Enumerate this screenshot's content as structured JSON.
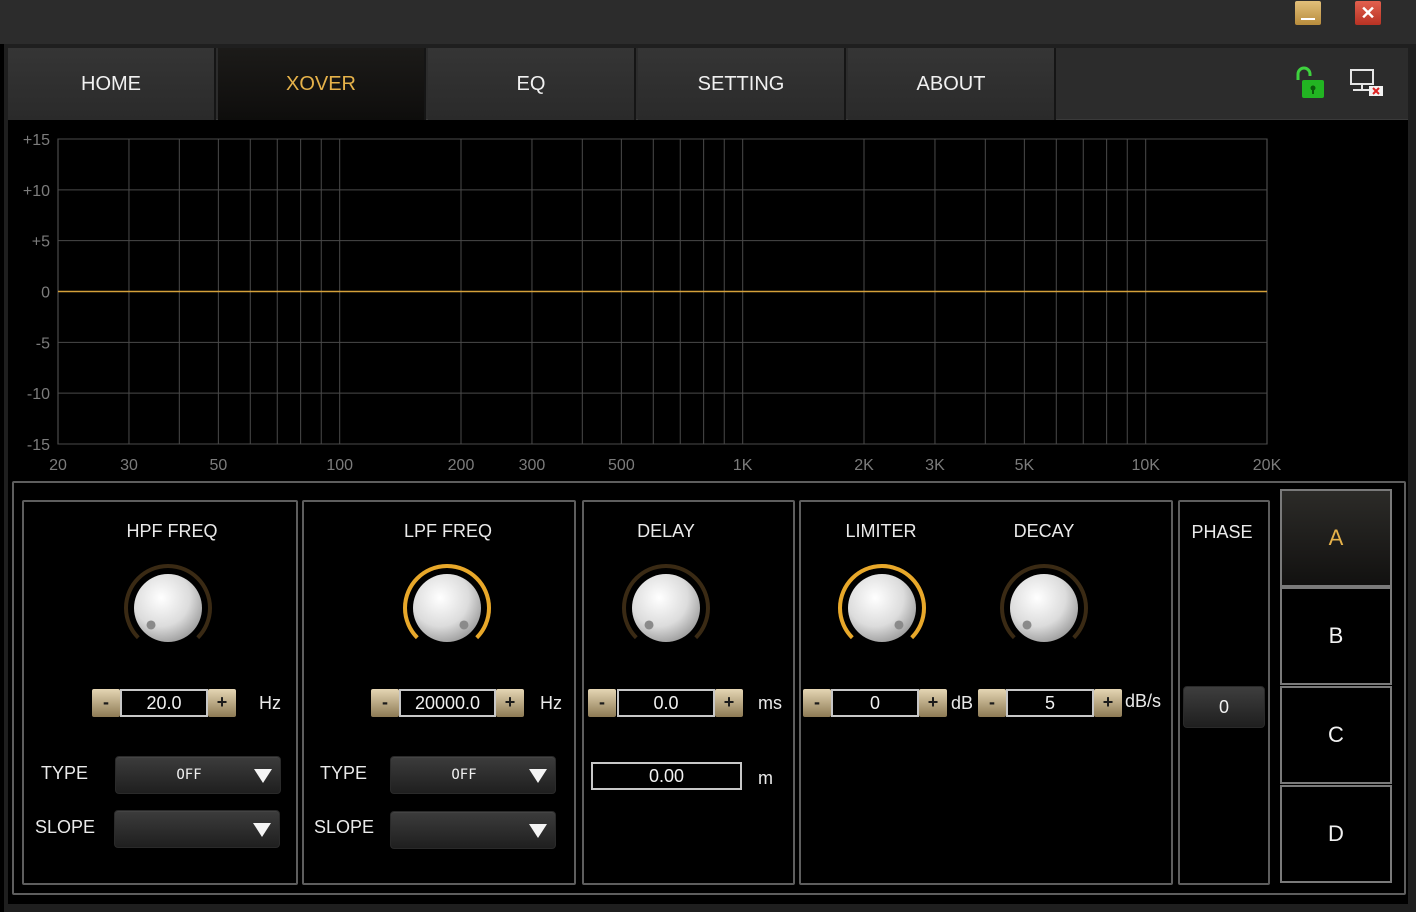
{
  "nav": {
    "tabs": [
      {
        "label": "HOME"
      },
      {
        "label": "XOVER",
        "active": true
      },
      {
        "label": "EQ"
      },
      {
        "label": "SETTING"
      },
      {
        "label": "ABOUT"
      }
    ],
    "icons": [
      "lock-open-icon",
      "network-disconnected-icon"
    ]
  },
  "graph": {
    "y_ticks": [
      "+15",
      "+10",
      "+5",
      "0",
      "-5",
      "-10",
      "-15"
    ],
    "x_ticks": [
      "20",
      "30",
      "50",
      "100",
      "200",
      "300",
      "500",
      "1K",
      "2K",
      "3K",
      "5K",
      "10K",
      "20K"
    ],
    "response_db": 0,
    "curve_color": "#d4a03a"
  },
  "hpf": {
    "title": "HPF FREQ",
    "value": "20.0",
    "unit": "Hz",
    "type_label": "TYPE",
    "type_value": "OFF",
    "slope_label": "SLOPE",
    "slope_value": "",
    "knob_level": 0.0
  },
  "lpf": {
    "title": "LPF FREQ",
    "value": "20000.0",
    "unit": "Hz",
    "type_label": "TYPE",
    "type_value": "OFF",
    "slope_label": "SLOPE",
    "slope_value": "",
    "knob_level": 1.0
  },
  "delay": {
    "title": "DELAY",
    "value": "0.0",
    "unit": "ms",
    "distance": "0.00",
    "distance_unit": "m",
    "knob_level": 0.0
  },
  "limiter": {
    "title": "LIMITER",
    "value": "0",
    "unit": "dB",
    "knob_level": 1.0
  },
  "decay": {
    "title": "DECAY",
    "value": "5",
    "unit": "dB/s",
    "knob_level": 0.0
  },
  "phase": {
    "title": "PHASE",
    "value": "0"
  },
  "channels": [
    {
      "label": "A",
      "active": true
    },
    {
      "label": "B"
    },
    {
      "label": "C"
    },
    {
      "label": "D"
    }
  ],
  "controls": {
    "minus": "-",
    "plus": "+"
  },
  "window": {
    "close_glyph": "✕"
  },
  "colors": {
    "accent": "#e6b24a",
    "knob_arc": "#e8a82a",
    "knob_track": "#3a2a14"
  }
}
